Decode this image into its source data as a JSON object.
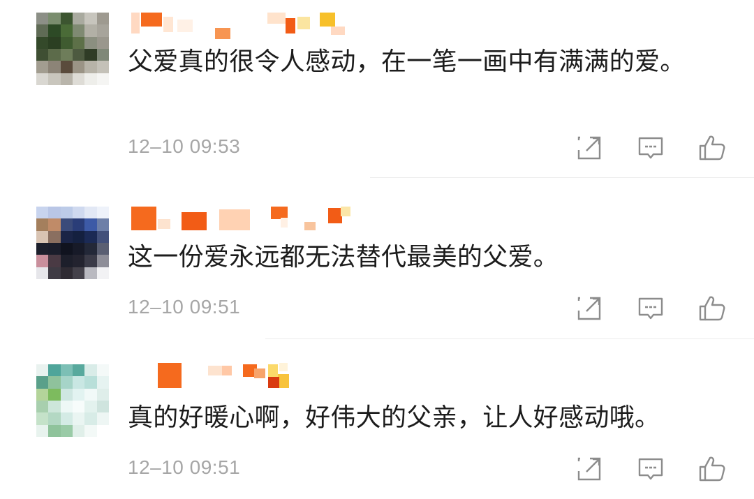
{
  "comments": [
    {
      "avatar_colors": [
        "#8c8f86",
        "#7a8d6e",
        "#3c5530",
        "#a9aa9f",
        "#c7c5bd",
        "#9e9a90",
        "#5f6b55",
        "#2d4a26",
        "#4a6b37",
        "#7f8a72",
        "#b2b0a6",
        "#a7a49b",
        "#34492a",
        "#2b3f22",
        "#3f5b30",
        "#5d7048",
        "#8b8f80",
        "#9a978d",
        "#3f4f33",
        "#5c6b4a",
        "#6e7d5a",
        "#4d5a40",
        "#2f3c26",
        "#7f8878",
        "#a29d90",
        "#8c8477",
        "#5a4b3c",
        "#9b9486",
        "#b7b3a8",
        "#c4c1b8",
        "#d9d7d1",
        "#c9c6bd",
        "#b9b5ab",
        "#dedcd6",
        "#eeeeea",
        "#f5f5f3"
      ],
      "name_colors": [
        "#ffd9c2",
        "#f56a1e",
        "#ffe6d3",
        "#fff1e6",
        "#f79552",
        "#ffe3cc",
        "#f25c16",
        "#fbe5a0",
        "#f7c02a"
      ],
      "text": "父爱真的很令人感动，在一笔一画中有满满的爱。",
      "time": "12–10 09:53"
    },
    {
      "avatar_colors": [
        "#c8d4ee",
        "#b9c6e6",
        "#bccbe8",
        "#cfd9ef",
        "#e2e8f5",
        "#eef2fa",
        "#a47f5d",
        "#c08b68",
        "#3b4b7a",
        "#2a3d78",
        "#3d5aa6",
        "#6d7fa8",
        "#d9c4b3",
        "#8a6f60",
        "#1a2446",
        "#14203f",
        "#1b2a55",
        "#42507a",
        "#1c1f2c",
        "#1a1d2b",
        "#10131f",
        "#171a28",
        "#232838",
        "#5a5f72",
        "#c98f9c",
        "#4a3a44",
        "#1d1f2b",
        "#23232f",
        "#3b3b48",
        "#8e8e98",
        "#e6e6ea",
        "#3f3b44",
        "#2f2b33",
        "#44414a",
        "#b9b9c0",
        "#f2f2f4"
      ],
      "name_colors": [
        "#f56a1e",
        "#fde3cf",
        "#f25c16",
        "#ffd2b3",
        "#f56a1e",
        "#fff0e4",
        "#f8c49d",
        "#f25c16",
        "#fbe6a8"
      ],
      "text": "这一份爱永远都无法替代最美的父爱。",
      "time": "12–10 09:51"
    },
    {
      "avatar_colors": [
        "#e9f2ef",
        "#4fa59a",
        "#7cbfb5",
        "#58a99d",
        "#d9ece8",
        "#f4f9f8",
        "#5aa08a",
        "#8fc29c",
        "#a6d4c8",
        "#c9e7e3",
        "#b8dfd9",
        "#e6f3f1",
        "#b4d49a",
        "#7dbb5e",
        "#cfe7e2",
        "#e2f3f1",
        "#f1f9f8",
        "#dfeeea",
        "#a8cfae",
        "#cde6da",
        "#eef8f6",
        "#f7fcfb",
        "#e3f2ee",
        "#cfe4de",
        "#c5e2c9",
        "#b3d8c3",
        "#d4ebe5",
        "#eaf5f2",
        "#d8ece7",
        "#eef6f4",
        "#e8f3ee",
        "#8fc39b",
        "#9acba7",
        "#e0efe9",
        "#f3f9f7",
        "#ffffff"
      ],
      "name_colors": [
        "#f56a1e",
        "#fde3cf",
        "#ffc8a6",
        "#f56a1e",
        "#f7a46b",
        "#fbd96a",
        "#f8c33b",
        "#d93a10",
        "#fff3d9"
      ],
      "text": "真的好暖心啊，好伟大的父亲，让人好感动哦。",
      "time": "12–10 09:51"
    }
  ],
  "icons": {
    "share": "share-icon",
    "reply": "reply-icon",
    "like": "like-icon"
  },
  "colors": {
    "text": "#1c1c1c",
    "time": "#a6a6a6",
    "icon": "#8c8c8c",
    "divider": "#ececec"
  }
}
